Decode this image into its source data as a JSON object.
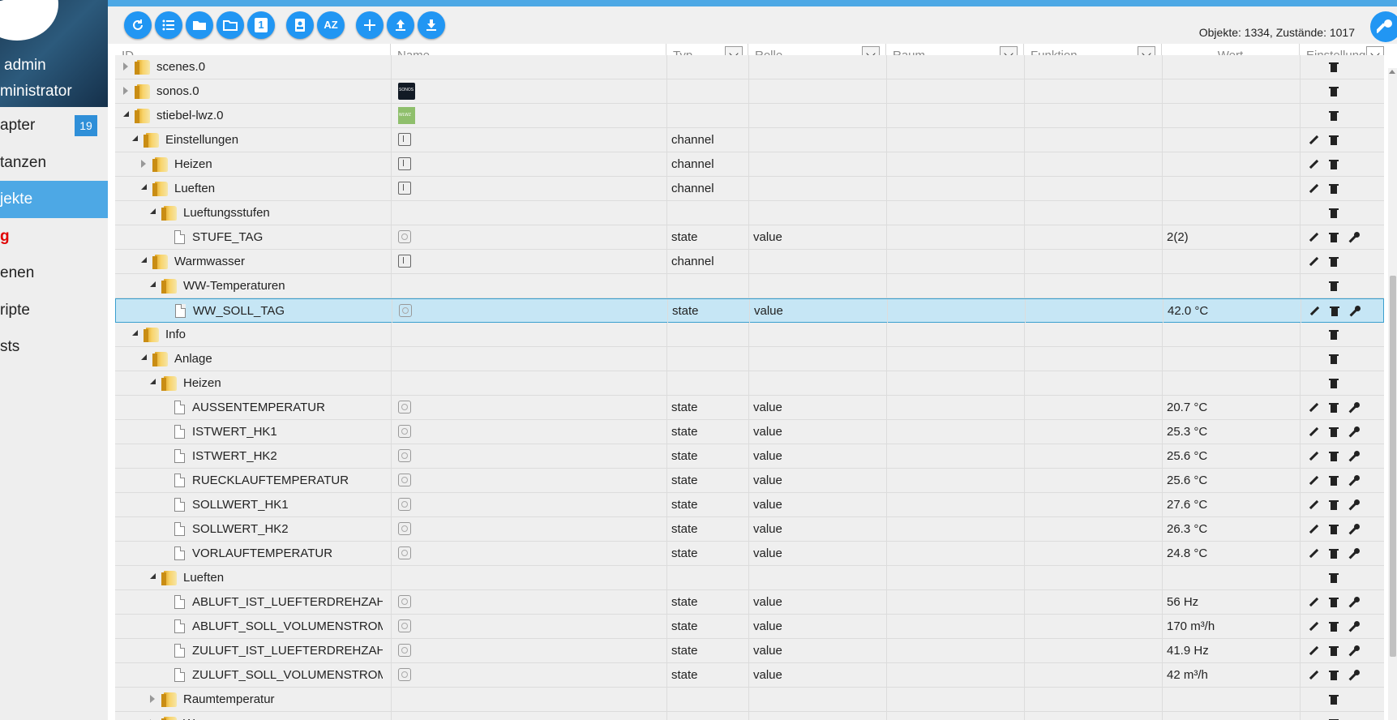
{
  "sidebar": {
    "user_name": "admin",
    "user_role": "ministrator",
    "items": [
      {
        "label": "apter",
        "badge": "19",
        "active": false,
        "style": "normal"
      },
      {
        "label": "tanzen",
        "active": false,
        "style": "normal"
      },
      {
        "label": "jekte",
        "active": true,
        "style": "normal"
      },
      {
        "label": "g",
        "active": false,
        "style": "red"
      },
      {
        "label": "enen",
        "active": false,
        "style": "normal"
      },
      {
        "label": "ripte",
        "active": false,
        "style": "normal"
      },
      {
        "label": "sts",
        "active": false,
        "style": "normal"
      }
    ]
  },
  "toolbar": {
    "buttons": [
      "refresh-icon",
      "list-icon",
      "folder-icon",
      "folder-open-icon",
      "number-one-icon",
      "contact-icon",
      "sort-az-icon",
      "add-icon",
      "upload-icon",
      "download-icon"
    ],
    "sort_label": "AZ",
    "one_label": "1",
    "object_count": "Objekte: 1334, Zustände: 1017"
  },
  "columns": {
    "id": "ID",
    "name": "Name",
    "type": "Typ",
    "role": "Rolle",
    "room": "Raum",
    "function": "Funktion",
    "value": "Wert",
    "settings": "Einstellunge"
  },
  "rows": [
    {
      "id": "scenes.0",
      "depth": 0,
      "toggle": "closed",
      "icon": "folder",
      "name_icon": "",
      "type": "",
      "role": "",
      "value": "",
      "actions": [
        "delete"
      ],
      "partial": true
    },
    {
      "id": "sonos.0",
      "depth": 0,
      "toggle": "closed",
      "icon": "folder",
      "name_icon": "sonos",
      "type": "",
      "role": "",
      "value": "",
      "actions": [
        "delete"
      ]
    },
    {
      "id": "stiebel-lwz.0",
      "depth": 0,
      "toggle": "open",
      "icon": "folder",
      "name_icon": "lwz",
      "type": "",
      "role": "",
      "value": "",
      "actions": [
        "delete"
      ]
    },
    {
      "id": "Einstellungen",
      "depth": 1,
      "toggle": "open",
      "icon": "folder",
      "name_icon": "channel",
      "type": "channel",
      "role": "",
      "value": "",
      "actions": [
        "edit",
        "delete"
      ]
    },
    {
      "id": "Heizen",
      "depth": 2,
      "toggle": "closed",
      "icon": "folder",
      "name_icon": "channel",
      "type": "channel",
      "role": "",
      "value": "",
      "actions": [
        "edit",
        "delete"
      ]
    },
    {
      "id": "Lueften",
      "depth": 2,
      "toggle": "open",
      "icon": "folder",
      "name_icon": "channel",
      "type": "channel",
      "role": "",
      "value": "",
      "actions": [
        "edit",
        "delete"
      ]
    },
    {
      "id": "Lueftungsstufen",
      "depth": 3,
      "toggle": "open",
      "icon": "folder",
      "name_icon": "",
      "type": "",
      "role": "",
      "value": "",
      "actions": [
        "delete"
      ]
    },
    {
      "id": "STUFE_TAG",
      "depth": 4,
      "toggle": "",
      "icon": "file",
      "name_icon": "state",
      "type": "state",
      "role": "value",
      "value": "2(2)",
      "actions": [
        "edit",
        "delete",
        "wrench"
      ]
    },
    {
      "id": "Warmwasser",
      "depth": 2,
      "toggle": "open",
      "icon": "folder",
      "name_icon": "channel",
      "type": "channel",
      "role": "",
      "value": "",
      "actions": [
        "edit",
        "delete"
      ]
    },
    {
      "id": "WW-Temperaturen",
      "depth": 3,
      "toggle": "open",
      "icon": "folder",
      "name_icon": "",
      "type": "",
      "role": "",
      "value": "",
      "actions": [
        "delete"
      ]
    },
    {
      "id": "WW_SOLL_TAG",
      "depth": 4,
      "toggle": "",
      "icon": "file",
      "name_icon": "state",
      "type": "state",
      "role": "value",
      "value": "42.0 °C",
      "actions": [
        "edit",
        "delete",
        "wrench"
      ],
      "selected": true
    },
    {
      "id": "Info",
      "depth": 1,
      "toggle": "open",
      "icon": "folder",
      "name_icon": "",
      "type": "",
      "role": "",
      "value": "",
      "actions": [
        "delete"
      ]
    },
    {
      "id": "Anlage",
      "depth": 2,
      "toggle": "open",
      "icon": "folder",
      "name_icon": "",
      "type": "",
      "role": "",
      "value": "",
      "actions": [
        "delete"
      ]
    },
    {
      "id": "Heizen",
      "depth": 3,
      "toggle": "open",
      "icon": "folder",
      "name_icon": "",
      "type": "",
      "role": "",
      "value": "",
      "actions": [
        "delete"
      ]
    },
    {
      "id": "AUSSENTEMPERATUR",
      "depth": 4,
      "toggle": "",
      "icon": "file",
      "name_icon": "state",
      "type": "state",
      "role": "value",
      "value": "20.7 °C",
      "actions": [
        "edit",
        "delete",
        "wrench"
      ]
    },
    {
      "id": "ISTWERT_HK1",
      "depth": 4,
      "toggle": "",
      "icon": "file",
      "name_icon": "state",
      "type": "state",
      "role": "value",
      "value": "25.3 °C",
      "actions": [
        "edit",
        "delete",
        "wrench"
      ]
    },
    {
      "id": "ISTWERT_HK2",
      "depth": 4,
      "toggle": "",
      "icon": "file",
      "name_icon": "state",
      "type": "state",
      "role": "value",
      "value": "25.6 °C",
      "actions": [
        "edit",
        "delete",
        "wrench"
      ]
    },
    {
      "id": "RUECKLAUFTEMPERATUR",
      "depth": 4,
      "toggle": "",
      "icon": "file",
      "name_icon": "state",
      "type": "state",
      "role": "value",
      "value": "25.6 °C",
      "actions": [
        "edit",
        "delete",
        "wrench"
      ]
    },
    {
      "id": "SOLLWERT_HK1",
      "depth": 4,
      "toggle": "",
      "icon": "file",
      "name_icon": "state",
      "type": "state",
      "role": "value",
      "value": "27.6 °C",
      "actions": [
        "edit",
        "delete",
        "wrench"
      ]
    },
    {
      "id": "SOLLWERT_HK2",
      "depth": 4,
      "toggle": "",
      "icon": "file",
      "name_icon": "state",
      "type": "state",
      "role": "value",
      "value": "26.3 °C",
      "actions": [
        "edit",
        "delete",
        "wrench"
      ]
    },
    {
      "id": "VORLAUFTEMPERATUR",
      "depth": 4,
      "toggle": "",
      "icon": "file",
      "name_icon": "state",
      "type": "state",
      "role": "value",
      "value": "24.8 °C",
      "actions": [
        "edit",
        "delete",
        "wrench"
      ]
    },
    {
      "id": "Lueften",
      "depth": 3,
      "toggle": "open",
      "icon": "folder",
      "name_icon": "",
      "type": "",
      "role": "",
      "value": "",
      "actions": [
        "delete"
      ]
    },
    {
      "id": "ABLUFT_IST_LUEFTERDREHZAHL",
      "depth": 4,
      "toggle": "",
      "icon": "file",
      "name_icon": "state",
      "type": "state",
      "role": "value",
      "value": "56 Hz",
      "actions": [
        "edit",
        "delete",
        "wrench"
      ]
    },
    {
      "id": "ABLUFT_SOLL_VOLUMENSTROM",
      "depth": 4,
      "toggle": "",
      "icon": "file",
      "name_icon": "state",
      "type": "state",
      "role": "value",
      "value": "170 m³/h",
      "actions": [
        "edit",
        "delete",
        "wrench"
      ]
    },
    {
      "id": "ZULUFT_IST_LUEFTERDREHZAHL",
      "depth": 4,
      "toggle": "",
      "icon": "file",
      "name_icon": "state",
      "type": "state",
      "role": "value",
      "value": "41.9 Hz",
      "actions": [
        "edit",
        "delete",
        "wrench"
      ]
    },
    {
      "id": "ZULUFT_SOLL_VOLUMENSTROM",
      "depth": 4,
      "toggle": "",
      "icon": "file",
      "name_icon": "state",
      "type": "state",
      "role": "value",
      "value": "42 m³/h",
      "actions": [
        "edit",
        "delete",
        "wrench"
      ]
    },
    {
      "id": "Raumtemperatur",
      "depth": 3,
      "toggle": "closed",
      "icon": "folder",
      "name_icon": "",
      "type": "",
      "role": "",
      "value": "",
      "actions": [
        "delete"
      ]
    },
    {
      "id": "W",
      "depth": 3,
      "toggle": "closed",
      "icon": "folder",
      "name_icon": "",
      "type": "",
      "role": "",
      "value": "",
      "actions": [
        "delete"
      ],
      "partial": true
    }
  ],
  "colors": {
    "accent": "#2196f3",
    "sidebar_active": "#4da8e5",
    "selected_row": "#c6e6f5",
    "badge": "#2f8fd8"
  }
}
